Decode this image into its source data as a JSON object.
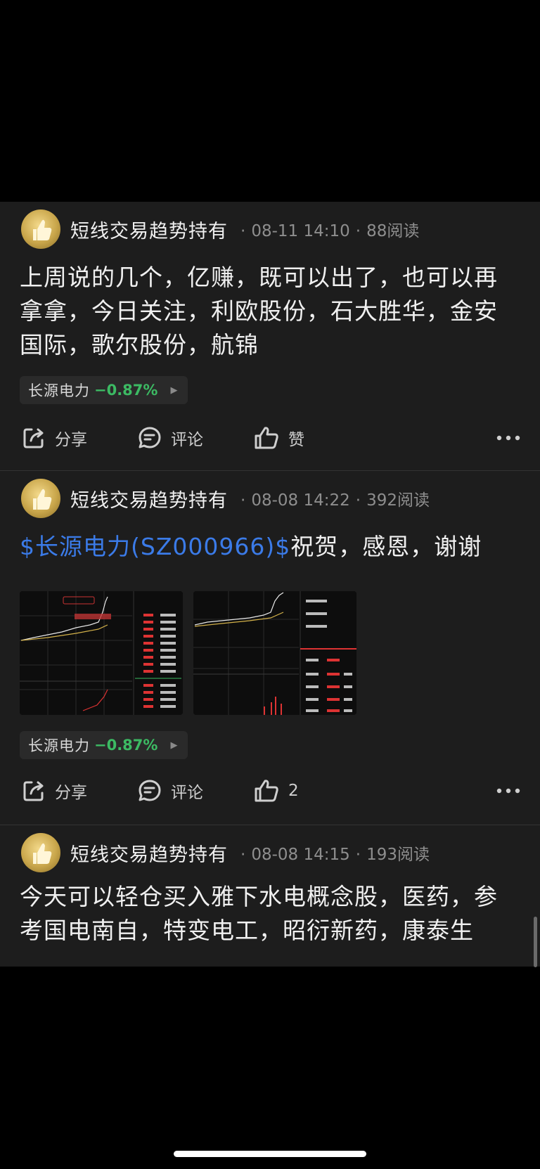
{
  "posts": [
    {
      "author": "短线交易趋势持有",
      "time": "08-11 14:10",
      "reads": "88阅读",
      "content": "上周说的几个，亿赚，既可以出了，也可以再拿拿，今日关注，利欧股份，石大胜华，金安国际，歌尔股份，航锦",
      "stock": {
        "name": "长源电力",
        "change": "−0.87%"
      },
      "actions": {
        "share": "分享",
        "comment": "评论",
        "like": "赞"
      }
    },
    {
      "author": "短线交易趋势持有",
      "time": "08-08 14:22",
      "reads": "392阅读",
      "content_link": "$长源电力(SZ000966)$",
      "content_text": "祝贺，感恩，谢谢",
      "stock": {
        "name": "长源电力",
        "change": "−0.87%"
      },
      "actions": {
        "share": "分享",
        "comment": "评论",
        "like": "2"
      }
    },
    {
      "author": "短线交易趋势持有",
      "time": "08-08 14:15",
      "reads": "193阅读",
      "content": "今天可以轻仓买入雅下水电概念股，医药，参考国电南自，特变电工，昭衍新药，康泰生"
    }
  ],
  "colors": {
    "positive": "#3cba63",
    "link": "#3b7be8",
    "background": "#1d1d1d"
  },
  "icons": [
    "avatar-thumbs-up",
    "share-icon",
    "comment-icon",
    "like-icon",
    "more-icon",
    "chevron-right-icon"
  ]
}
